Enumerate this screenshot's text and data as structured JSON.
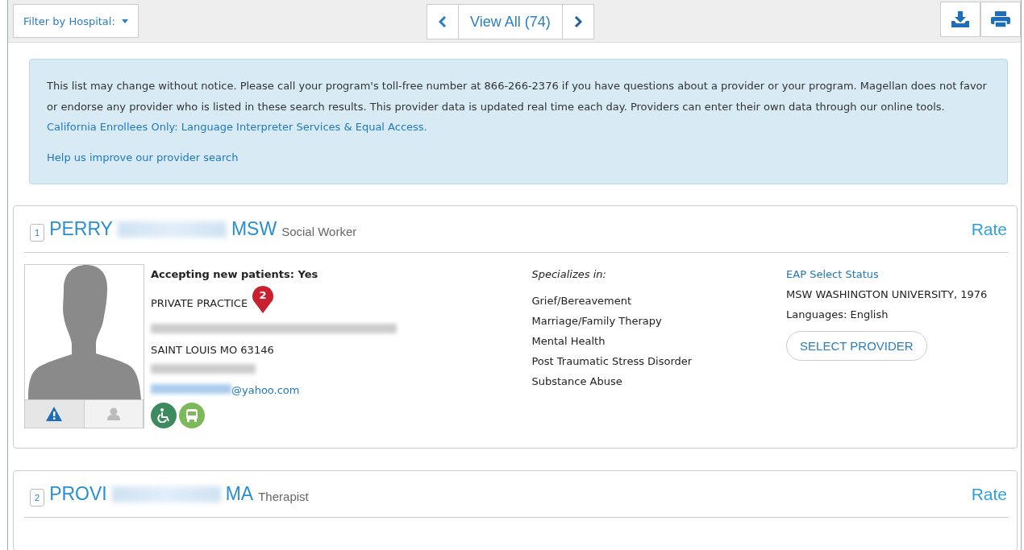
{
  "toolbar": {
    "filter_label": "Filter by Hospital:",
    "view_all": "View All (74)"
  },
  "notice": {
    "text": "This list may change without notice. Please call your program's toll-free number at 866-266-2376 if you have questions about a provider or your program. Magellan does not favor or endorse any provider who is listed in these search results. This provider data is updated real time each day. Providers can enter their own data through our online tools. ",
    "link": "California Enrollees Only: Language Interpreter Services & Equal Access.",
    "feedback_link": "Help us improve our provider search"
  },
  "providers": [
    {
      "number": "1",
      "name_start": "PERRY",
      "name_end": "MSW",
      "role": "Social Worker",
      "rate": "Rate",
      "accepting": "Accepting new patients: Yes",
      "practice": "PRIVATE PRACTICE",
      "pin": "2",
      "city": "SAINT LOUIS MO 63146",
      "email_domain": "@yahoo.com",
      "photo_tabs": [
        {
          "kind": "warning",
          "selected": true
        },
        {
          "kind": "person",
          "selected": false
        }
      ],
      "amenities": [
        {
          "kind": "wheelchair",
          "color": "#3e8a5f"
        },
        {
          "kind": "bus",
          "color": "#7db95b"
        }
      ],
      "specializes_label": "Specializes in:",
      "specialties": [
        "Grief/Bereavement",
        "Marriage/Family Therapy",
        "Mental Health",
        "Post Traumatic Stress Disorder",
        "Substance Abuse"
      ],
      "status_link": "EAP Select Status",
      "education": "MSW WASHINGTON UNIVERSITY, 1976",
      "languages": "Languages: English",
      "select_button": "SELECT PROVIDER"
    },
    {
      "number": "2",
      "name_start": "PROVI",
      "name_end": "MA",
      "role": "Therapist",
      "rate": "Rate"
    }
  ]
}
